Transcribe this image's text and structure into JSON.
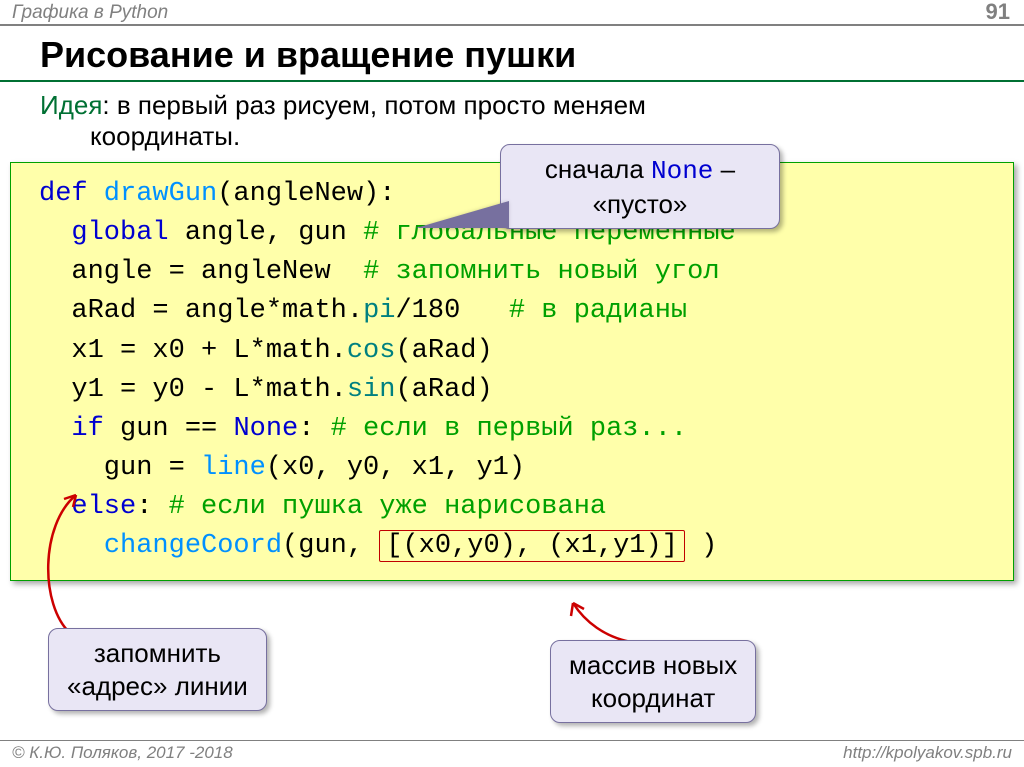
{
  "header": {
    "course": "Графика в Python",
    "page": "91"
  },
  "title": "Рисование и вращение пушки",
  "idea": {
    "label": "Идея",
    "line1": ": в первый раз рисуем, потом просто меняем",
    "line2": "координаты."
  },
  "code": {
    "l1_def": "def",
    "l1_func": " drawGun",
    "l1_rest": "(angleNew):",
    "l2_global": "  global",
    "l2_vars": " angle, gun ",
    "l2_comment": "# глобальные переменные",
    "l3_assign": "  angle = angleNew  ",
    "l3_comment": "# запомнить новый угол",
    "l4_a": "  aRad = angle*math.",
    "l4_b": "pi",
    "l4_c": "/180   ",
    "l4_comment": "# в радианы",
    "l5_a": "  x1 = x0 + L*math.",
    "l5_b": "cos",
    "l5_c": "(aRad)",
    "l6_a": "  y1 = y0 - L*math.",
    "l6_b": "sin",
    "l6_c": "(aRad)",
    "l7_if": "  if",
    "l7_mid": " gun == ",
    "l7_none": "None",
    "l7_colon": ": ",
    "l7_comment": "# если в первый раз...",
    "l8_a": "    gun = ",
    "l8_b": "line",
    "l8_c": "(x0, y0, x1, y1)",
    "l9_else": "  else",
    "l9_colon": ": ",
    "l9_comment": "# если пушка уже нарисована",
    "l10_a": "    ",
    "l10_b": "changeCoord",
    "l10_c": "(gun, ",
    "l10_box": "[(x0,y0), (x1,y1)]",
    "l10_d": " )"
  },
  "callouts": {
    "top": {
      "before": "сначала ",
      "mono": "None",
      "after": " –",
      "line2": "«пусто»"
    },
    "left": {
      "line1": "запомнить",
      "line2": "«адрес» линии"
    },
    "right": {
      "line1": "массив новых",
      "line2": "координат"
    }
  },
  "footer": {
    "left": "© К.Ю. Поляков, 2017 -2018",
    "right": "http://kpolyakov.spb.ru"
  }
}
